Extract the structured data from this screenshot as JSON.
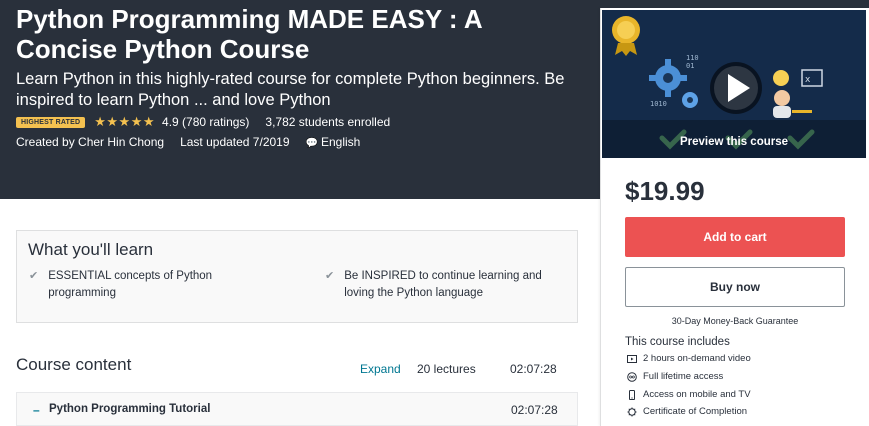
{
  "hero": {
    "title": "Python Programming MADE EASY : A Concise Python Course",
    "subtitle": "Learn Python in this highly-rated course for complete Python beginners. Be inspired to learn Python ... and love Python",
    "badge": "HIGHEST RATED",
    "stars": "★★★★★",
    "rating": "4.9 (780 ratings)",
    "enrolled": "3,782 students enrolled",
    "created_by": "Created by Cher Hin Chong",
    "last_updated": "Last updated 7/2019",
    "language": "English"
  },
  "learn": {
    "title": "What you'll learn",
    "items": [
      "ESSENTIAL concepts of Python programming",
      "Be INSPIRED to continue learning and loving the Python language"
    ]
  },
  "course_content": {
    "title": "Course content",
    "expand_label": "Expand",
    "lectures": "20 lectures",
    "total_time": "02:07:28",
    "sections": [
      {
        "toggle": "–",
        "title": "Python Programming Tutorial",
        "time": "02:07:28"
      }
    ]
  },
  "sidebar": {
    "preview_label": "Preview this course",
    "price": "$19.99",
    "add_to_cart": "Add to cart",
    "buy_now": "Buy now",
    "guarantee": "30-Day Money-Back Guarantee",
    "includes_title": "This course includes",
    "includes": [
      {
        "icon": "video-icon",
        "label": "2 hours on-demand video"
      },
      {
        "icon": "infinity-icon",
        "label": "Full lifetime access"
      },
      {
        "icon": "mobile-icon",
        "label": "Access on mobile and TV"
      },
      {
        "icon": "certificate-icon",
        "label": "Certificate of Completion"
      }
    ]
  },
  "colors": {
    "hero_bg": "#29303b",
    "accent_red": "#ec5252",
    "link_teal": "#007791",
    "star_gold": "#f4c150"
  }
}
